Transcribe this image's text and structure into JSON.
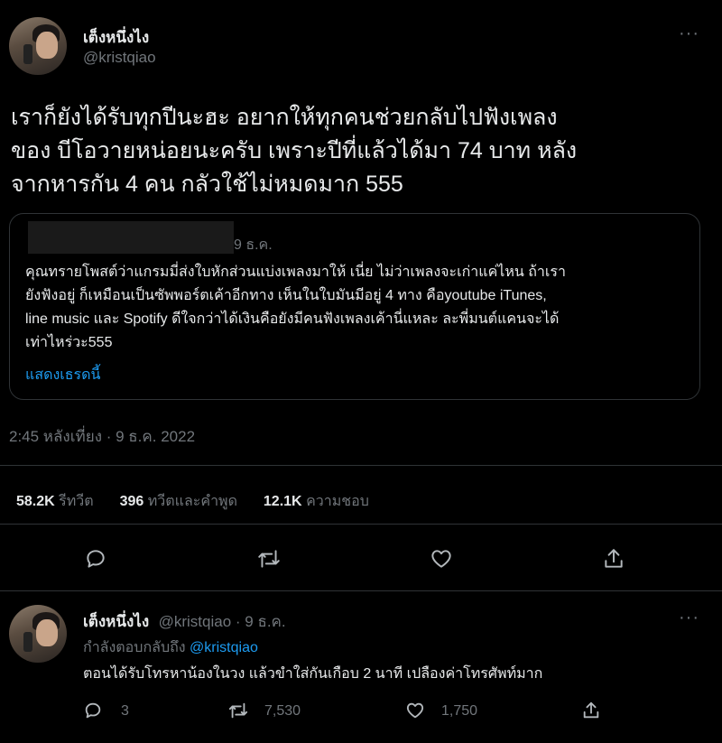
{
  "tweet": {
    "author_name": "เต็งหนึ่งไง",
    "author_handle": "@kristqiao",
    "more": "···",
    "text_lines": [
      "เราก็ยังได้รับทุกปีนะฮะ อยากให้ทุกคนช่วยกลับไปฟังเพลง",
      "ของ บีโอวายหน่อยนะครับ เพราะปีที่แล้วได้มา 74 บาท หลัง",
      "จากหารกัน 4 คน กลัวใช้ไม่หมดมาก 555"
    ],
    "timestamp": "2:45 หลังเที่ยง · 9 ธ.ค. 2022"
  },
  "quote": {
    "date": "9 ธ.ค.",
    "text_lines": [
      "คุณทรายโพสต์ว่าแกรมมี่ส่งใบหักส่วนแบ่งเพลงมาให้ เนี่ย ไม่ว่าเพลงจะเก่าแค่ไหน ถ้าเรา",
      "ยังฟังอยู่ ก็เหมือนเป็นซัพพอร์ตเค้าอีกทาง เห็นในใบมันมีอยู่ 4 ทาง คือyoutube iTunes,",
      "line music และ Spotify ดีใจกว่าได้เงินคือยังมีคนฟังเพลงเค้านี่แหละ ละพี่มนต์แคนจะได้",
      "เท่าไหร่วะ555"
    ],
    "show_thread": "แสดงเธรดนี้"
  },
  "stats": {
    "retweets_num": "58.2K",
    "retweets_label": "รีทวีต",
    "quotes_num": "396",
    "quotes_label": "ทวีตและคำพูด",
    "likes_num": "12.1K",
    "likes_label": "ความชอบ"
  },
  "reply": {
    "author_name": "เต็งหนึ่งไง",
    "author_meta": "@kristqiao · 9 ธ.ค.",
    "replying_to_label": "กำลังตอบกลับถึง",
    "replying_to_handle": "@kristqiao",
    "text": "ตอนได้รับโทรหาน้องในวง แล้วขำใส่กันเกือบ 2 นาที เปลืองค่าโทรศัพท์มาก",
    "reply_count": "3",
    "retweet_count": "7,530",
    "like_count": "1,750",
    "more": "···"
  },
  "icons": {
    "reply": "reply-icon",
    "retweet": "retweet-icon",
    "like": "heart-icon",
    "share": "share-icon"
  },
  "colors": {
    "background": "#000000",
    "text": "#e7e9ea",
    "muted": "#71767b",
    "link": "#1d9bf0",
    "border": "#2f3336"
  }
}
